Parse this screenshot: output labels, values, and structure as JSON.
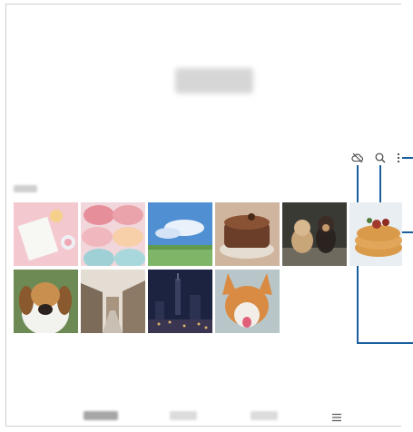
{
  "header": {
    "title": ""
  },
  "toolbar": {
    "icons": [
      "cloud-off-icon",
      "search-icon",
      "more-options-icon"
    ]
  },
  "section": {
    "label": ""
  },
  "gallery": {
    "thumbnails": [
      {
        "subject": "notebook-and-drink",
        "colors": [
          "#f3c9cf",
          "#e9eef4"
        ]
      },
      {
        "subject": "macarons",
        "colors": [
          "#e9a3a8",
          "#9fd0d6"
        ]
      },
      {
        "subject": "blue-sky-landscape",
        "colors": [
          "#4f8fd2",
          "#7fb567"
        ]
      },
      {
        "subject": "chocolate-cake",
        "colors": [
          "#6b3e2a",
          "#cfb59e"
        ]
      },
      {
        "subject": "chihuahua-and-cat",
        "colors": [
          "#3a3a34",
          "#c9a57a"
        ]
      },
      {
        "subject": "pancakes",
        "colors": [
          "#d99a4a",
          "#a33a2e"
        ]
      },
      {
        "subject": "beagle-dog",
        "colors": [
          "#c98f4f",
          "#f2f2ee"
        ]
      },
      {
        "subject": "old-town-street",
        "colors": [
          "#a89580",
          "#e4ddd3"
        ]
      },
      {
        "subject": "city-skyline-night",
        "colors": [
          "#1b2340",
          "#d9b36a"
        ]
      },
      {
        "subject": "corgi-dog",
        "colors": [
          "#d98b43",
          "#f3efe8"
        ]
      }
    ]
  },
  "bottom_nav": {
    "tabs": [
      "",
      "",
      ""
    ],
    "menu_icon": "menu-icon"
  },
  "colors": {
    "callout": "#1b5e9e",
    "frame": "#cfcfcf"
  }
}
